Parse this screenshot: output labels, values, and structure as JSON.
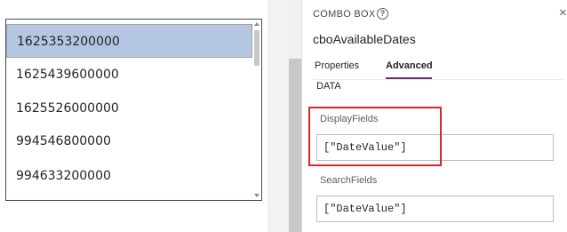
{
  "combo_list": {
    "items": [
      {
        "label": "1625353200000",
        "selected": true
      },
      {
        "label": "1625439600000",
        "selected": false
      },
      {
        "label": "1625526000000",
        "selected": false
      },
      {
        "label": "994546800000",
        "selected": false
      },
      {
        "label": "994633200000",
        "selected": false
      }
    ]
  },
  "pane": {
    "control_type": "COMBO BOX",
    "help_icon": "?",
    "close_icon": "×",
    "control_name": "cboAvailableDates",
    "tabs": [
      {
        "label": "Properties",
        "active": false
      },
      {
        "label": "Advanced",
        "active": true
      }
    ],
    "section_title": "DATA",
    "fields": [
      {
        "label": "DisplayFields",
        "value": "[\"DateValue\"]"
      },
      {
        "label": "SearchFields",
        "value": "[\"DateValue\"]"
      }
    ]
  },
  "colors": {
    "selected_row": "#b5c6e2",
    "tab_accent": "#742774",
    "highlight_border": "#d9262d"
  }
}
